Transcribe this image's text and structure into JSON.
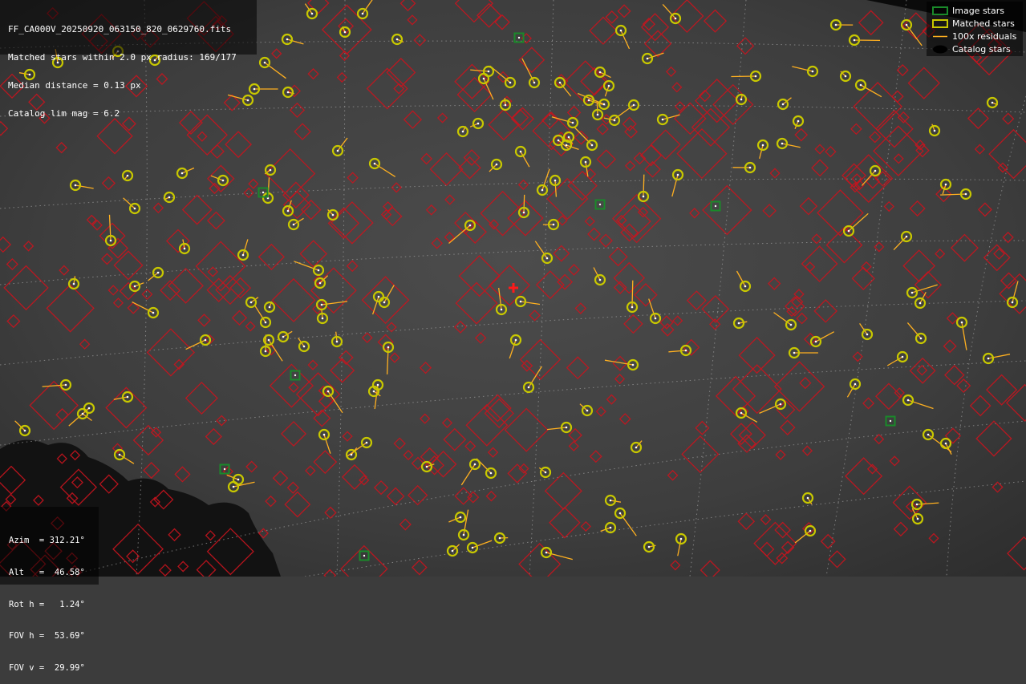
{
  "info": {
    "filename": "FF_CA000V_20250920_063150_820_0629760.fits",
    "matched_line": "Matched stars within 2.0 px radius: 169/177",
    "median_line": "Median distance = 0.13 px",
    "catalog_line": "Catalog lim mag = 6.2"
  },
  "pointing": {
    "azim": "Azim  = 312.21°",
    "alt": "Alt   =  46.58°",
    "rot": "Rot h =   1.24°",
    "fov_h": "FOV h =  53.69°",
    "fov_v": "FOV v =  29.99°"
  },
  "legend": {
    "image_stars": "Image stars",
    "matched_stars": "Matched stars",
    "residuals": "100x residuals",
    "catalog_stars": "Catalog stars"
  },
  "colors": {
    "image_star": "#1a8a2a",
    "matched_star": "#c8c800",
    "residual": "#ffb020",
    "catalog_star": "#c8141e",
    "grid": "#9a9a9a",
    "center_marker": "#ff1a1a"
  }
}
